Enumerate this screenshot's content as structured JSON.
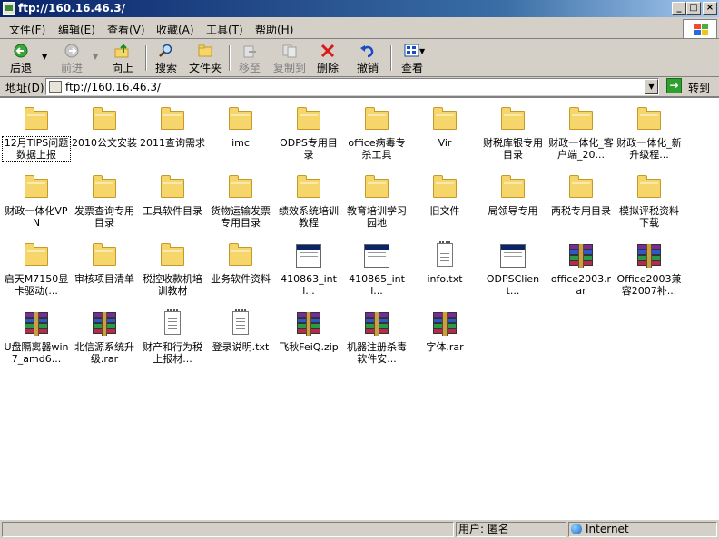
{
  "window": {
    "title": "ftp://160.16.46.3/"
  },
  "menu": [
    "文件(F)",
    "编辑(E)",
    "查看(V)",
    "收藏(A)",
    "工具(T)",
    "帮助(H)"
  ],
  "toolbar": {
    "back": "后退",
    "forward": "前进",
    "up": "向上",
    "search": "搜索",
    "folders": "文件夹",
    "move_to": "移至",
    "copy_to": "复制到",
    "delete": "删除",
    "undo": "撤销",
    "views": "查看"
  },
  "address": {
    "label": "地址(D)",
    "value": "ftp://160.16.46.3/",
    "go_label": "转到"
  },
  "files": [
    {
      "name": "12月TIPS问题数据上报",
      "type": "folder"
    },
    {
      "name": "2010公文安装",
      "type": "folder"
    },
    {
      "name": "2011查询需求",
      "type": "folder"
    },
    {
      "name": "imc",
      "type": "folder"
    },
    {
      "name": "ODPS专用目录",
      "type": "folder"
    },
    {
      "name": "office病毒专杀工具",
      "type": "folder"
    },
    {
      "name": "Vir",
      "type": "folder"
    },
    {
      "name": "财税库银专用目录",
      "type": "folder"
    },
    {
      "name": "财政一体化_客户端_20...",
      "type": "folder"
    },
    {
      "name": "财政一体化_新升级程...",
      "type": "folder"
    },
    {
      "name": "财政一体化VPN",
      "type": "folder"
    },
    {
      "name": "发票查询专用目录",
      "type": "folder"
    },
    {
      "name": "工具软件目录",
      "type": "folder"
    },
    {
      "name": "货物运输发票专用目录",
      "type": "folder"
    },
    {
      "name": "绩效系统培训教程",
      "type": "folder"
    },
    {
      "name": "教育培训学习园地",
      "type": "folder"
    },
    {
      "name": "旧文件",
      "type": "folder"
    },
    {
      "name": "局领导专用",
      "type": "folder"
    },
    {
      "name": "两税专用目录",
      "type": "folder"
    },
    {
      "name": "模拟评税资料下载",
      "type": "folder"
    },
    {
      "name": "启天M7150显卡驱动(...",
      "type": "folder"
    },
    {
      "name": "审核项目清单",
      "type": "folder"
    },
    {
      "name": "税控收款机培训教材",
      "type": "folder"
    },
    {
      "name": "业务软件资料",
      "type": "folder"
    },
    {
      "name": "410863_intl...",
      "type": "exe"
    },
    {
      "name": "410865_intl...",
      "type": "exe"
    },
    {
      "name": "info.txt",
      "type": "txt"
    },
    {
      "name": "ODPSClient...",
      "type": "exe"
    },
    {
      "name": "office2003.rar",
      "type": "rar"
    },
    {
      "name": "Office2003兼容2007补...",
      "type": "rar"
    },
    {
      "name": "U盘隔离器win7_amd6...",
      "type": "rar"
    },
    {
      "name": "北信源系统升级.rar",
      "type": "rar"
    },
    {
      "name": "财产和行为税上报材...",
      "type": "txt"
    },
    {
      "name": "登录说明.txt",
      "type": "txt"
    },
    {
      "name": "飞秋FeiQ.zip",
      "type": "rar"
    },
    {
      "name": "机器注册杀毒软件安...",
      "type": "rar"
    },
    {
      "name": "字体.rar",
      "type": "rar"
    }
  ],
  "status": {
    "user": "用户: 匿名",
    "zone": "Internet"
  }
}
